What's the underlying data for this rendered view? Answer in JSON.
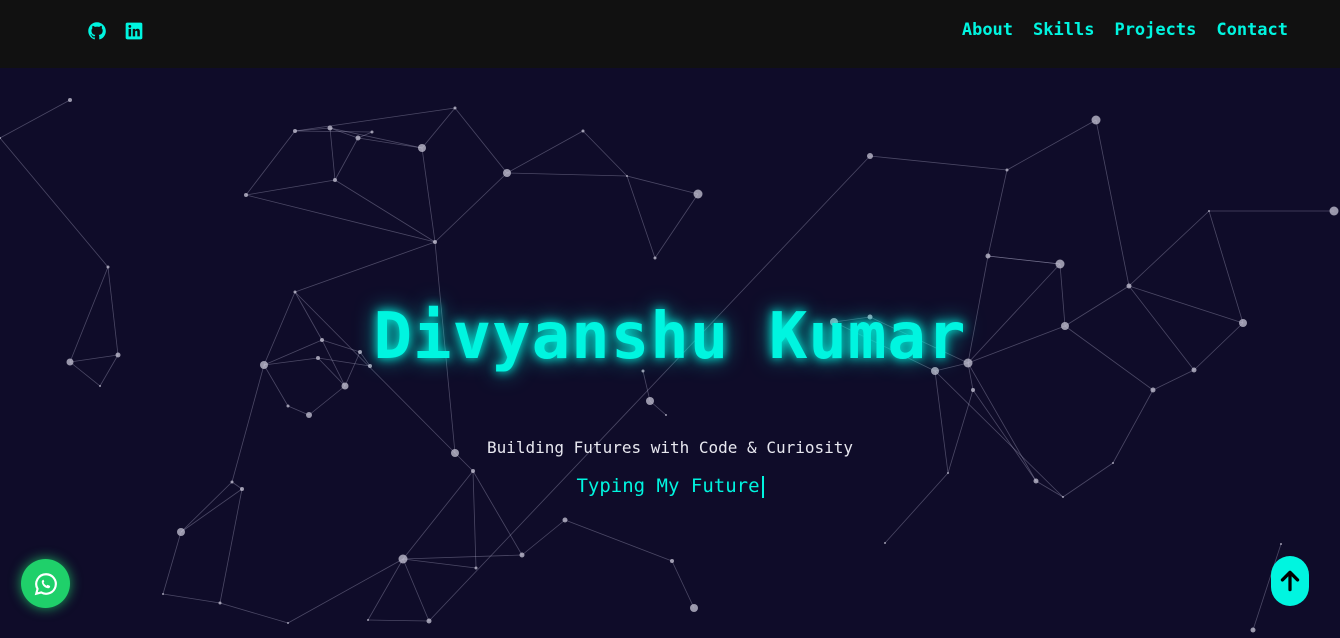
{
  "header": {
    "social": [
      {
        "icon": "github-icon"
      },
      {
        "icon": "linkedin-icon"
      }
    ],
    "nav": [
      "About",
      "Skills",
      "Projects",
      "Contact"
    ]
  },
  "hero": {
    "name": "Divyanshu Kumar",
    "tagline": "Building Futures with Code & Curiosity",
    "typing_text": "Typing My Future"
  },
  "floating": {
    "whatsapp_icon": "whatsapp-icon",
    "scroll_top_icon": "arrow-up-icon"
  },
  "colors": {
    "accent": "#00f5e0",
    "background": "#0f0c29",
    "header_bg": "#111111",
    "whatsapp": "#1fd06a"
  }
}
